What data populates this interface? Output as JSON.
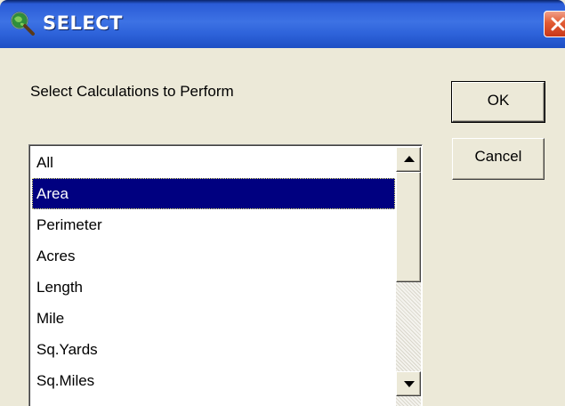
{
  "window": {
    "title": "SELECT",
    "title_icon": "globe-magnifier-icon",
    "close_icon": "close-icon"
  },
  "dialog": {
    "prompt": "Select Calculations to Perform",
    "ok_label": "OK",
    "cancel_label": "Cancel"
  },
  "list": {
    "selected": "Area",
    "items": [
      {
        "label": "All"
      },
      {
        "label": "Area"
      },
      {
        "label": "Perimeter"
      },
      {
        "label": "Acres"
      },
      {
        "label": "Length"
      },
      {
        "label": "Mile"
      },
      {
        "label": "Sq.Yards"
      },
      {
        "label": "Sq.Miles"
      }
    ]
  },
  "colors": {
    "selection_bg": "#000080",
    "titlebar": "#2E63DA",
    "dialog_bg": "#ECE9D8"
  }
}
